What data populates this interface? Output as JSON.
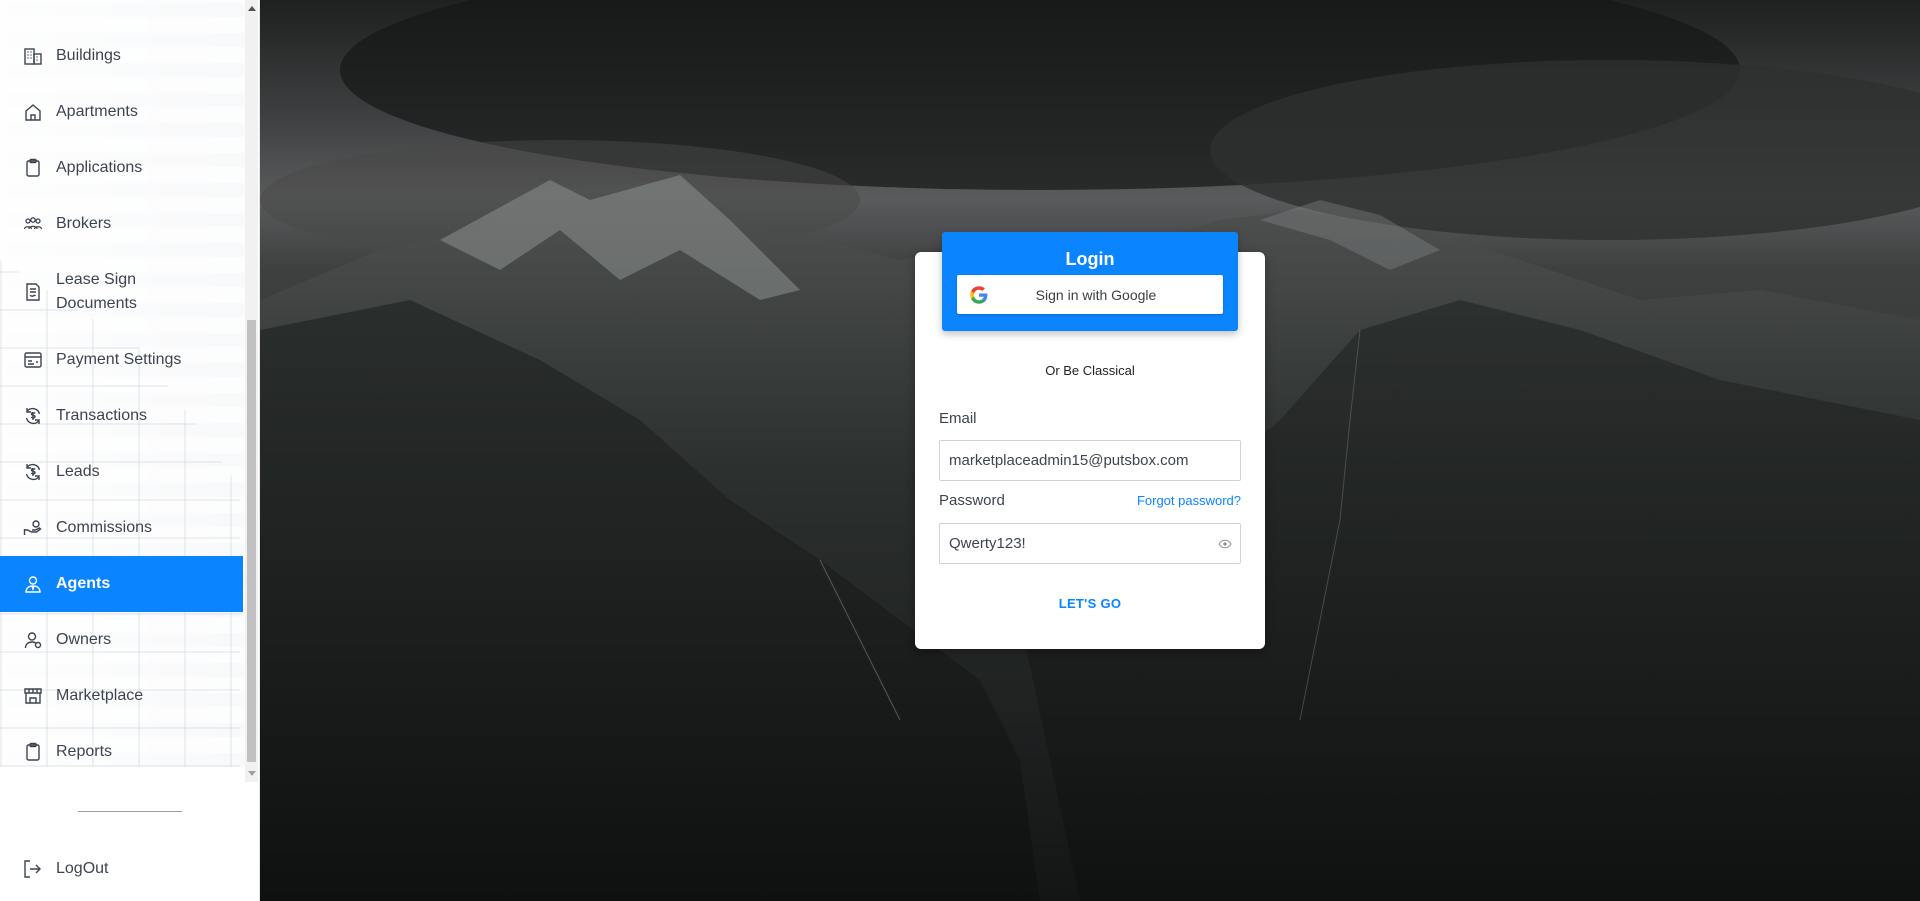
{
  "sidebar": {
    "items": [
      {
        "label": "Buildings",
        "icon": "buildings-icon"
      },
      {
        "label": "Apartments",
        "icon": "home-icon"
      },
      {
        "label": "Applications",
        "icon": "clipboard-icon"
      },
      {
        "label": "Brokers",
        "icon": "people-icon"
      },
      {
        "label": "Lease Sign Documents",
        "icon": "document-sign-icon"
      },
      {
        "label": "Payment Settings",
        "icon": "payment-settings-icon"
      },
      {
        "label": "Transactions",
        "icon": "dollar-cycle-icon"
      },
      {
        "label": "Leads",
        "icon": "dollar-cycle-icon"
      },
      {
        "label": "Commissions",
        "icon": "hand-money-icon"
      },
      {
        "label": "Agents",
        "icon": "agent-icon",
        "active": true
      },
      {
        "label": "Owners",
        "icon": "owner-icon"
      },
      {
        "label": "Marketplace",
        "icon": "store-icon"
      },
      {
        "label": "Reports",
        "icon": "clipboard-icon"
      }
    ],
    "logout_label": "LogOut"
  },
  "login": {
    "title": "Login",
    "google_label": "Sign in with Google",
    "or_text": "Or Be Classical",
    "email_label": "Email",
    "email_value": "marketplaceadmin15@putsbox.com",
    "password_label": "Password",
    "forgot_label": "Forgot password?",
    "password_value": "Qwerty123!",
    "submit_label": "LET'S GO"
  },
  "colors": {
    "accent": "#0a84ff",
    "text": "#3d4451"
  }
}
